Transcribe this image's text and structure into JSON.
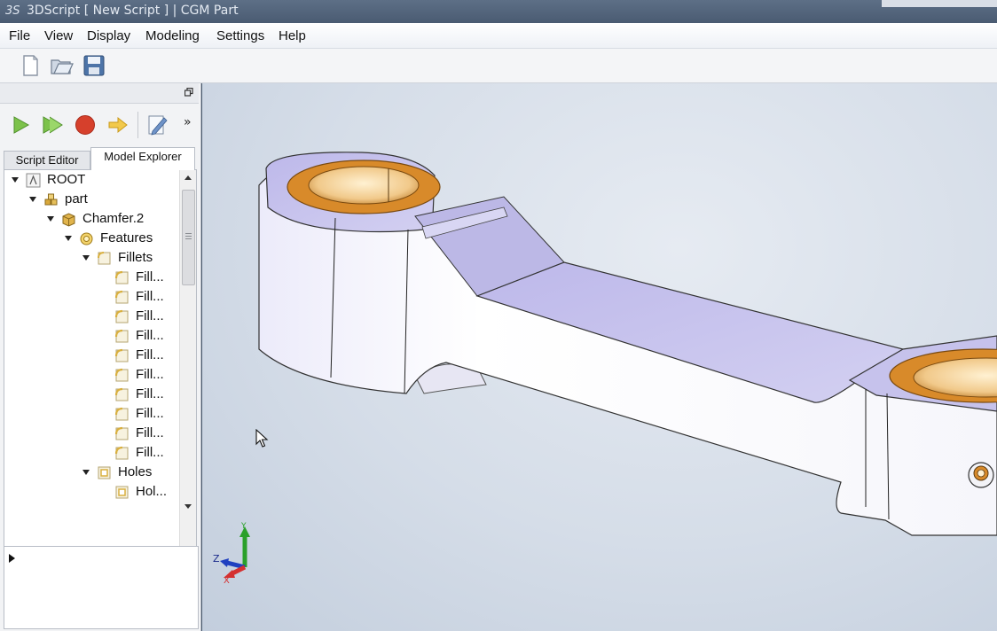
{
  "window": {
    "title": "3DScript [ New Script ] | CGM Part",
    "logo_text": "3S"
  },
  "menu": [
    {
      "label": "File"
    },
    {
      "label": "View"
    },
    {
      "label": "Display"
    },
    {
      "label": "Modeling"
    },
    {
      "label": "Settings"
    },
    {
      "label": "Help"
    }
  ],
  "toolbar": {
    "icons": [
      "new-document-icon",
      "open-folder-icon",
      "save-disk-icon"
    ]
  },
  "panel": {
    "run_icons": [
      "run-icon",
      "run-step-icon",
      "stop-record-icon",
      "step-arrow-icon",
      "edit-script-icon"
    ],
    "more_label": "»",
    "tabs": [
      {
        "label": "Script Editor",
        "active": false
      },
      {
        "label": "Model Explorer",
        "active": true
      }
    ]
  },
  "tree": {
    "rows": [
      {
        "label": "ROOT",
        "icon": "root-icon",
        "expanded": true
      },
      {
        "label": "part",
        "icon": "part-icon",
        "expanded": true
      },
      {
        "label": "Chamfer.2",
        "icon": "body-icon",
        "expanded": true
      },
      {
        "label": "Features",
        "icon": "features-icon",
        "expanded": true
      },
      {
        "label": "Fillets",
        "icon": "folder-icon",
        "expanded": true
      },
      {
        "label": "Fill..."
      },
      {
        "label": "Fill..."
      },
      {
        "label": "Fill..."
      },
      {
        "label": "Fill..."
      },
      {
        "label": "Fill..."
      },
      {
        "label": "Fill..."
      },
      {
        "label": "Fill..."
      },
      {
        "label": "Fill..."
      },
      {
        "label": "Fill..."
      },
      {
        "label": "Fill..."
      },
      {
        "label": "Holes",
        "icon": "folder-icon",
        "expanded": true
      },
      {
        "label": "Hol..."
      }
    ]
  },
  "colors": {
    "bushing": "#d88a2a",
    "model_top": "#c8c4ec",
    "model_side": "#ffffff",
    "axis_x": "#d43030",
    "axis_y": "#2aa02a",
    "axis_z": "#2040c0"
  },
  "viewport": {
    "axes": {
      "x": "X",
      "y": "Y",
      "z": "Z"
    }
  }
}
